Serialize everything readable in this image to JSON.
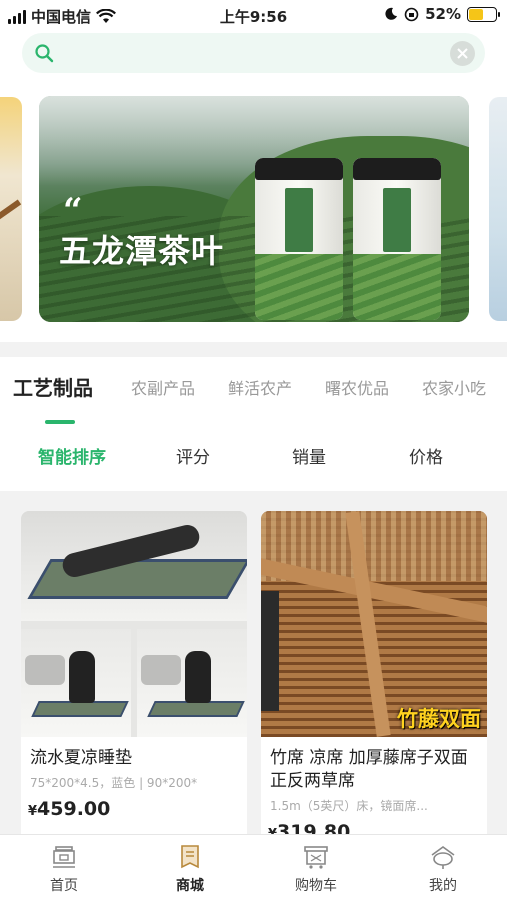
{
  "status_bar": {
    "carrier": "中国电信",
    "time": "上午9:56",
    "battery": "52%"
  },
  "search": {
    "placeholder": ""
  },
  "banner": {
    "quote": "“",
    "title": "五龙潭茶叶"
  },
  "categories": [
    {
      "label": "工艺制品",
      "active": true
    },
    {
      "label": "农副产品",
      "active": false
    },
    {
      "label": "鲜活农产",
      "active": false
    },
    {
      "label": "曙农优品",
      "active": false
    },
    {
      "label": "农家小吃",
      "active": false
    }
  ],
  "sort": [
    {
      "label": "智能排序",
      "active": true
    },
    {
      "label": "评分",
      "active": false
    },
    {
      "label": "销量",
      "active": false
    },
    {
      "label": "价格",
      "active": false
    }
  ],
  "products": [
    {
      "name": "流水夏凉睡垫",
      "spec": "75*200*4.5，蓝色 | 90*200*",
      "currency": "¥",
      "price": "459.00"
    },
    {
      "name": "竹席 凉席 加厚藤席子双面正反两草席",
      "spec": "1.5m（5英尺）床，镜面席...",
      "currency": "¥",
      "price": "319.80",
      "image_tag": "竹藤双面"
    }
  ],
  "bottom_nav": [
    {
      "label": "首页",
      "icon": "home-icon",
      "active": false
    },
    {
      "label": "商城",
      "icon": "mall-icon",
      "active": true
    },
    {
      "label": "购物车",
      "icon": "cart-icon",
      "active": false
    },
    {
      "label": "我的",
      "icon": "profile-icon",
      "active": false
    }
  ],
  "colors": {
    "accent": "#2ab56c",
    "search_bg": "#eef8f3"
  }
}
